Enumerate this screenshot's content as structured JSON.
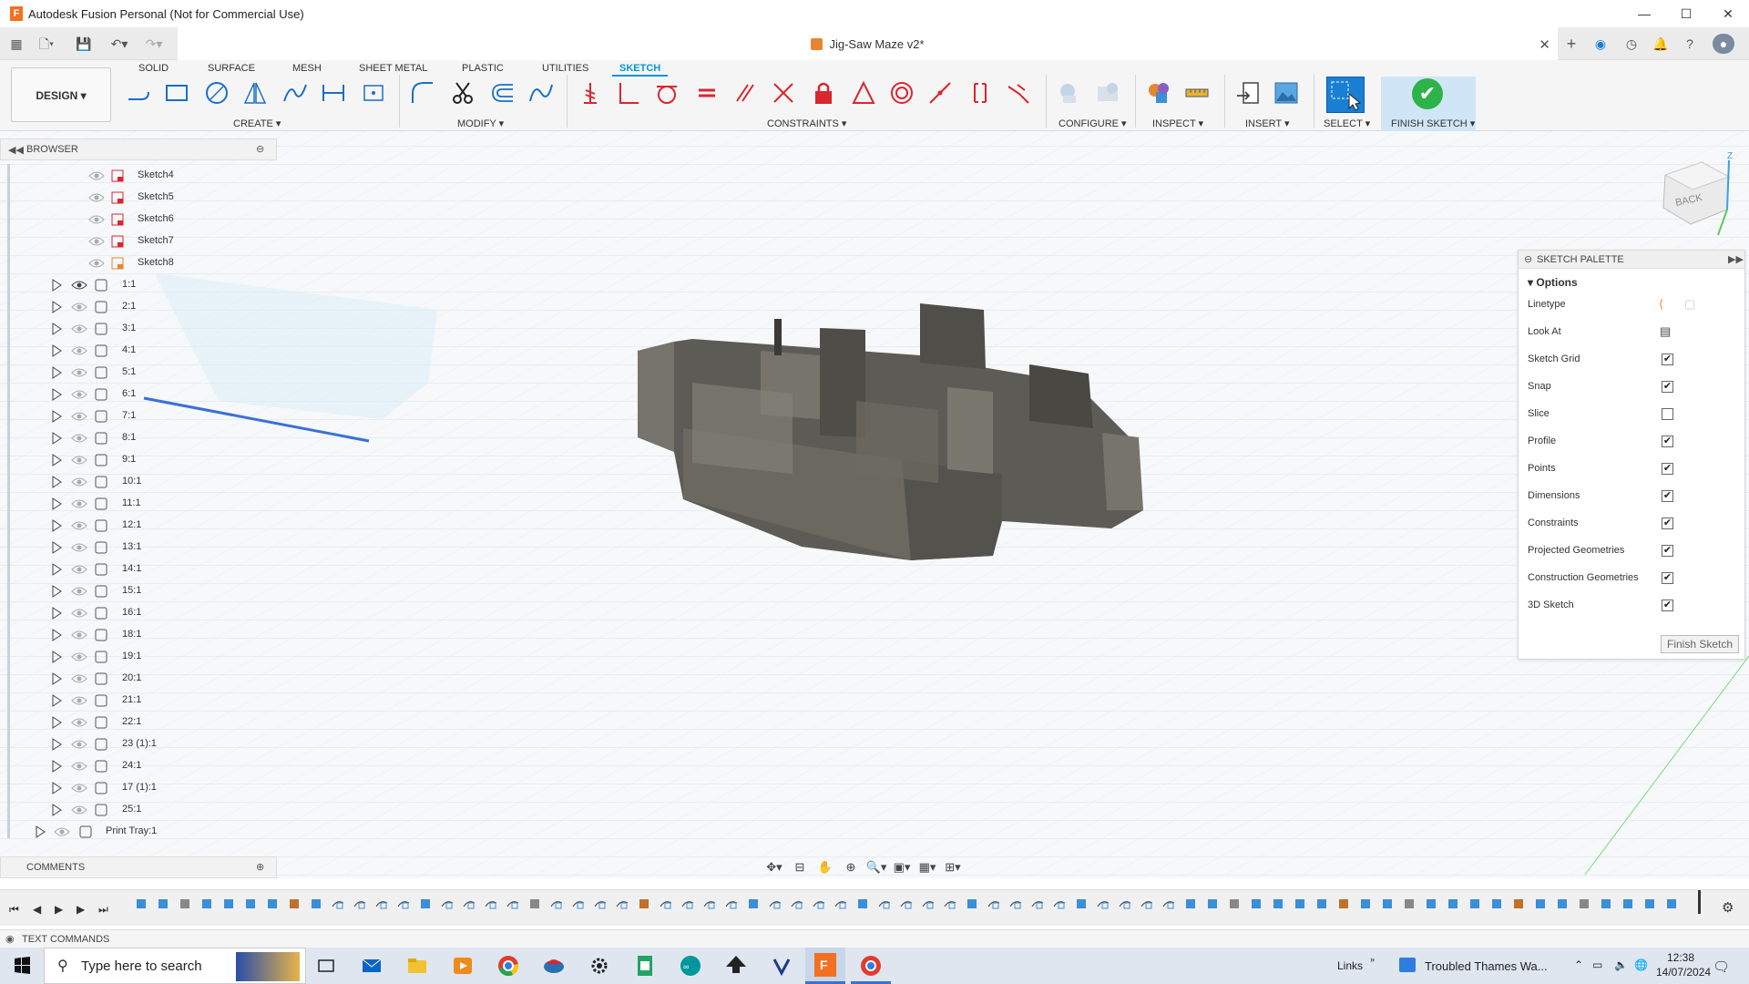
{
  "window": {
    "title": "Autodesk Fusion Personal (Not for Commercial Use)",
    "doc_tab": "Jig-Saw Maze v2*"
  },
  "toolbar": {
    "workspace": "DESIGN ▾",
    "tabs": [
      "SOLID",
      "SURFACE",
      "MESH",
      "SHEET METAL",
      "PLASTIC",
      "UTILITIES",
      "SKETCH"
    ],
    "active_tab": "SKETCH",
    "groups": {
      "create": "CREATE ▾",
      "modify": "MODIFY ▾",
      "constraints": "CONSTRAINTS ▾",
      "configure": "CONFIGURE ▾",
      "inspect": "INSPECT ▾",
      "insert": "INSERT ▾",
      "select": "SELECT ▾",
      "finish": "FINISH SKETCH ▾"
    }
  },
  "browser": {
    "title": "BROWSER",
    "sketches": [
      "Sketch4",
      "Sketch5",
      "Sketch6",
      "Sketch7",
      "Sketch8"
    ],
    "components": [
      "1:1",
      "2:1",
      "3:1",
      "4:1",
      "5:1",
      "6:1",
      "7:1",
      "8:1",
      "9:1",
      "10:1",
      "11:1",
      "12:1",
      "13:1",
      "14:1",
      "15:1",
      "16:1",
      "18:1",
      "19:1",
      "20:1",
      "21:1",
      "22:1",
      "23 (1):1",
      "24:1",
      "17 (1):1",
      "25:1"
    ],
    "print_tray": "Print Tray:1"
  },
  "comments": {
    "title": "COMMENTS"
  },
  "text_commands": {
    "title": "TEXT COMMANDS"
  },
  "palette": {
    "title": "SKETCH PALETTE",
    "section": "Options",
    "rows": [
      {
        "label": "Linetype"
      },
      {
        "label": "Look At"
      },
      {
        "label": "Sketch Grid",
        "checked": "✔"
      },
      {
        "label": "Snap",
        "checked": "✔"
      },
      {
        "label": "Slice",
        "checked": ""
      },
      {
        "label": "Profile",
        "checked": "✔"
      },
      {
        "label": "Points",
        "checked": "✔"
      },
      {
        "label": "Dimensions",
        "checked": "✔"
      },
      {
        "label": "Constraints",
        "checked": "✔"
      },
      {
        "label": "Projected Geometries",
        "checked": "✔"
      },
      {
        "label": "Construction Geometries",
        "checked": "✔"
      },
      {
        "label": "3D Sketch",
        "checked": "✔"
      }
    ],
    "finish_button": "Finish Sketch"
  },
  "viewcube": {
    "face": "BACK",
    "axis": "Z"
  },
  "taskbar": {
    "search_placeholder": "Type here to search",
    "links": "Links",
    "news": "Troubled Thames Wa...",
    "time": "12:38",
    "date": "14/07/2024"
  }
}
